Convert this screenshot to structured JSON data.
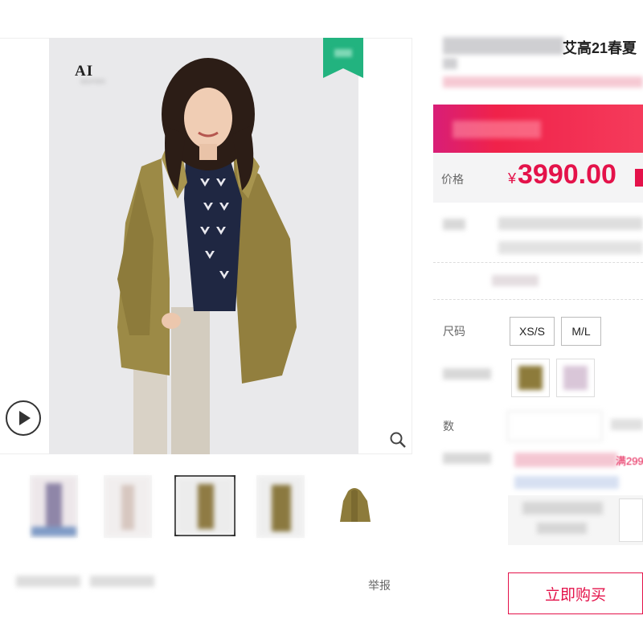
{
  "gallery": {
    "brand_logo": "AI",
    "brand_sub": "DEPOS",
    "play_icon": "play-icon",
    "zoom_icon": "zoom-icon",
    "thumbnails": [
      {
        "name": "thumb-1",
        "active": false
      },
      {
        "name": "thumb-2",
        "active": false
      },
      {
        "name": "thumb-3",
        "active": true
      },
      {
        "name": "thumb-4",
        "active": false
      },
      {
        "name": "thumb-5",
        "active": false
      }
    ],
    "report_label": "举报"
  },
  "product": {
    "title_visible": "艾高21春夏",
    "price_label": "价格",
    "currency": "¥",
    "price": "3990.00",
    "size_label": "尺码",
    "sizes": [
      "XS/S",
      "M/L"
    ],
    "qty_label": "数",
    "promo_fragment": "满299",
    "buy_now_label": "立即购买"
  },
  "colors": {
    "accent": "#e4124a",
    "promo_gradient_start": "#d81e77",
    "ribbon_green": "#22b37f"
  }
}
